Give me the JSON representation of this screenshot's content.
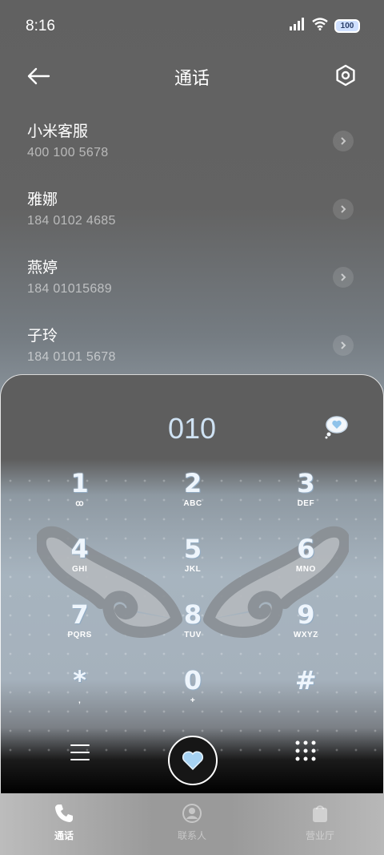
{
  "status_bar": {
    "time": "8:16",
    "battery": "100",
    "icons": [
      "signal-icon",
      "wifi-icon",
      "battery-icon"
    ]
  },
  "header": {
    "title": "通话",
    "back_icon": "arrow-left-icon",
    "settings_icon": "hexagon-settings-icon"
  },
  "call_list": [
    {
      "name": "小米客服",
      "number": "400 100 5678"
    },
    {
      "name": "雅娜",
      "number": "184 0102 4685"
    },
    {
      "name": "燕婷",
      "number": "184 01015689"
    },
    {
      "name": "子玲",
      "number": "184 0101 5678"
    }
  ],
  "dialer": {
    "input": "010",
    "keys": [
      {
        "digit": "1",
        "letters": "ꝏ"
      },
      {
        "digit": "2",
        "letters": "ABC"
      },
      {
        "digit": "3",
        "letters": "DEF"
      },
      {
        "digit": "4",
        "letters": "GHI"
      },
      {
        "digit": "5",
        "letters": "JKL"
      },
      {
        "digit": "6",
        "letters": "MNO"
      },
      {
        "digit": "7",
        "letters": "PQRS"
      },
      {
        "digit": "8",
        "letters": "TUV"
      },
      {
        "digit": "9",
        "letters": "WXYZ"
      },
      {
        "digit": "*",
        "letters": ","
      },
      {
        "digit": "0",
        "letters": "+"
      },
      {
        "digit": "#",
        "letters": ""
      }
    ]
  },
  "bottom_nav": [
    {
      "label": "通话",
      "icon": "phone-icon",
      "active": true
    },
    {
      "label": "联系人",
      "icon": "contact-icon",
      "active": false
    },
    {
      "label": "营业厅",
      "icon": "store-icon",
      "active": false
    }
  ],
  "colors": {
    "accent": "#cfe2f3",
    "background": "#616161"
  }
}
